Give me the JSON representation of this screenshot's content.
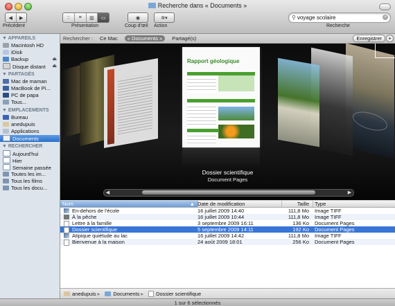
{
  "window": {
    "title": "Recherche dans « Documents »",
    "status": "1 sur 6 sélectionnés"
  },
  "toolbar": {
    "back_label": "Précédent",
    "view_label": "Présentation",
    "quicklook_label": "Coup d'œil",
    "action_label": "Action",
    "search_label": "Recherche",
    "search_value": "voyage scolaire",
    "view_modes": [
      "icons",
      "list",
      "columns",
      "coverflow"
    ],
    "active_view": "coverflow"
  },
  "sidebar": {
    "sections": [
      {
        "title": "APPAREILS",
        "items": [
          "Macintosh HD",
          "iDisk",
          "Backup",
          "Disque distant"
        ]
      },
      {
        "title": "PARTAGÉS",
        "items": [
          "Mac de maman",
          "MacBook de Pi...",
          "PC de papa",
          "Tous..."
        ]
      },
      {
        "title": "EMPLACEMENTS",
        "items": [
          "Bureau",
          "anedupuis",
          "Applications",
          "Documents"
        ]
      },
      {
        "title": "RECHERCHER",
        "items": [
          "Aujourd'hui",
          "Hier",
          "Semaine passée",
          "Toutes les im...",
          "Tous les films",
          "Tous les docu..."
        ]
      }
    ],
    "selected_item": "Documents"
  },
  "scope": {
    "label": "Rechercher :",
    "options": [
      "Ce Mac",
      "« Documents »",
      "Partagé(s)"
    ],
    "active": "« Documents »",
    "save_label": "Enregistrer",
    "add_label": "+"
  },
  "coverflow": {
    "title": "Dossier scientifique",
    "subtitle": "Document Pages",
    "doc_heading": "Rapport géologique"
  },
  "list": {
    "columns": [
      "Nom",
      "Date de modification",
      "Taille",
      "Type"
    ],
    "sorted_column": "Nom",
    "rows": [
      {
        "name": "En-dehors de l'école",
        "date": "16 juillet 2009 14:40",
        "size": "111,8 Mo",
        "type": "Image TIFF",
        "icon": "tiff"
      },
      {
        "name": "À la pêche",
        "date": "16 juillet 2009 10:44",
        "size": "111,8 Mo",
        "type": "Image TIFF",
        "icon": "trash"
      },
      {
        "name": "Lettre à la famille",
        "date": "3 septembre 2009 16:11",
        "size": "136 Ko",
        "type": "Document Pages",
        "icon": "pages"
      },
      {
        "name": "Dossier scientifique",
        "date": "5 septembre 2009 14:11",
        "size": "192 Ko",
        "type": "Document Pages",
        "icon": "pages"
      },
      {
        "name": "Atipique quiétude au lac",
        "date": "16 juillet 2009 14:42",
        "size": "111,8 Mo",
        "type": "Image TIFF",
        "icon": "tiff"
      },
      {
        "name": "Bienvenue à la maison",
        "date": "24 août 2009 18:01",
        "size": "256 Ko",
        "type": "Document Pages",
        "icon": "pages"
      }
    ],
    "selected_index": 3
  },
  "pathbar": {
    "items": [
      "anedupuis",
      "Documents",
      "Dossier scientifique"
    ]
  }
}
